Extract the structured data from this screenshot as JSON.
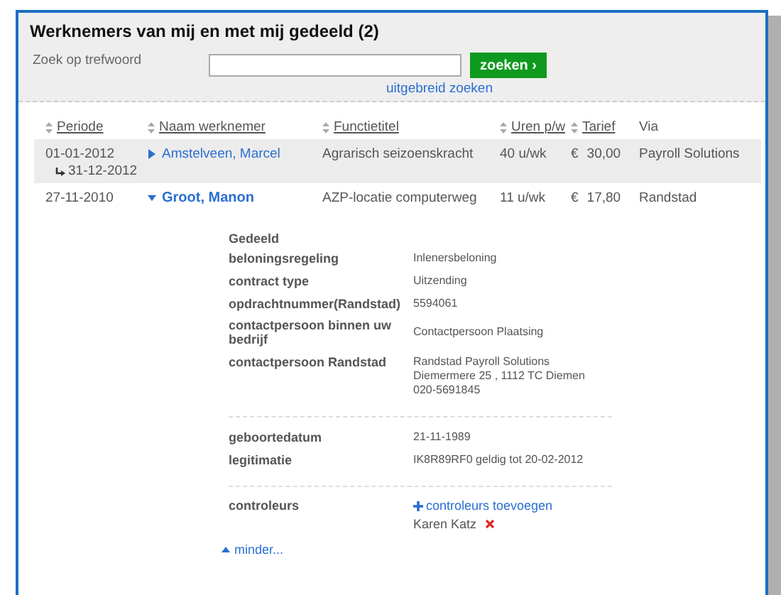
{
  "title": "Werknemers van mij en met mij gedeeld (2)",
  "search": {
    "label": "Zoek op trefwoord",
    "button": "zoeken ›",
    "advanced_link": "uitgebreid zoeken"
  },
  "table": {
    "columns": [
      {
        "label": "Periode",
        "sortable": true
      },
      {
        "label": "Naam werknemer",
        "sortable": true
      },
      {
        "label": "Functietitel",
        "sortable": true
      },
      {
        "label": "Uren p/w",
        "sortable": true
      },
      {
        "label": "Tarief",
        "sortable": true
      },
      {
        "label": "Via",
        "sortable": false
      }
    ],
    "rows": [
      {
        "start": "01-01-2012",
        "end": "31-12-2012",
        "name": "Amstelveen, Marcel",
        "expanded": false,
        "highlighted": true,
        "function": "Agrarisch seizoenskracht",
        "hours": "40 u/wk",
        "currency": "€",
        "rate": "30,00",
        "via": "Payroll Solutions"
      },
      {
        "start": "27-11-2010",
        "name": "Groot, Manon",
        "expanded": true,
        "highlighted": false,
        "function": "AZP-locatie computerweg",
        "hours": "11 u/wk",
        "currency": "€",
        "rate": "17,80",
        "via": "Randstad"
      }
    ]
  },
  "details": {
    "heading": "Gedeeld",
    "sections": [
      {
        "fields": [
          {
            "label": "beloningsregeling",
            "lines": [
              "Inlenersbeloning"
            ]
          },
          {
            "label": "contract type",
            "lines": [
              "Uitzending"
            ]
          },
          {
            "label": "opdrachtnummer(Randstad)",
            "lines": [
              "5594061"
            ]
          },
          {
            "label": "contactpersoon binnen uw bedrijf",
            "lines": [
              "Contactpersoon Plaatsing"
            ]
          },
          {
            "label": "contactpersoon Randstad",
            "lines": [
              "Randstad Payroll Solutions",
              "Diemermere 25 , 1112 TC Diemen",
              "020-5691845"
            ]
          }
        ]
      },
      {
        "fields": [
          {
            "label": "geboortedatum",
            "lines": [
              "21-11-1989"
            ]
          },
          {
            "label": "legitimatie",
            "lines": [
              "IK8R89RF0  geldig tot 20-02-2012"
            ]
          }
        ]
      }
    ],
    "controllers": {
      "label": "controleurs",
      "add_link": "controleurs toevoegen",
      "people": [
        {
          "name": "Karen Katz"
        }
      ]
    },
    "less_link": "minder..."
  }
}
